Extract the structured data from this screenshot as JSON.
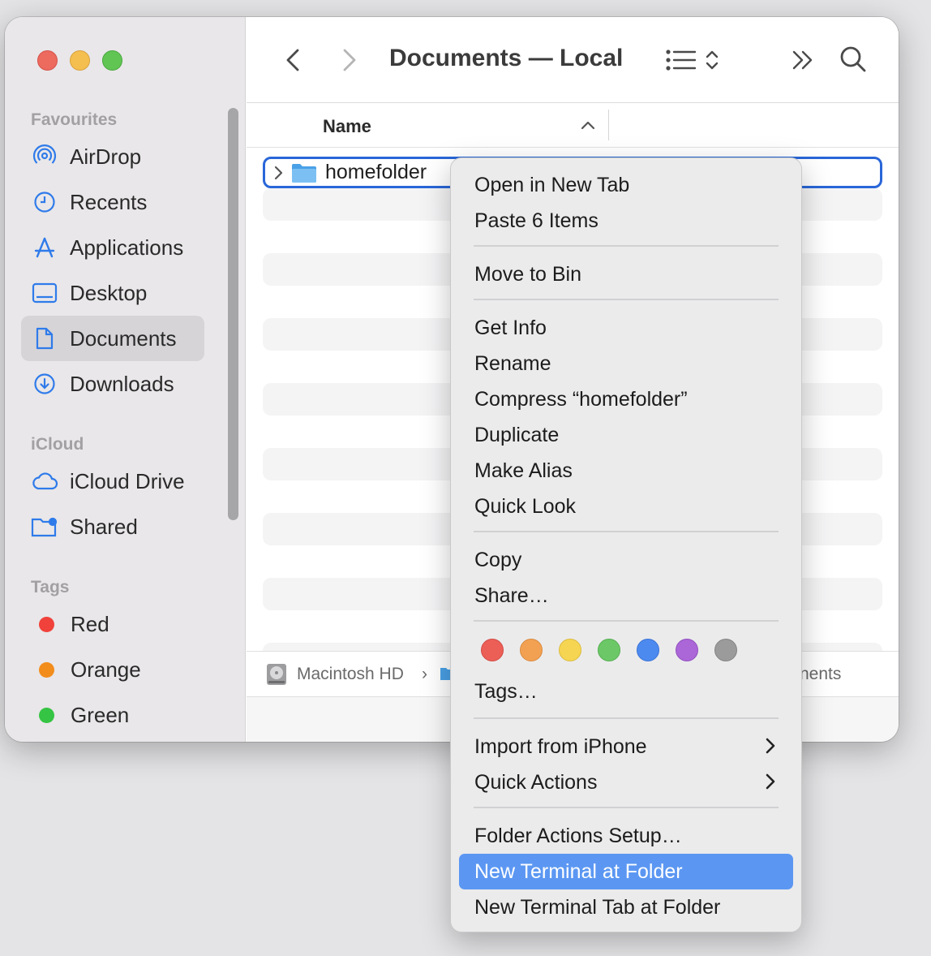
{
  "window": {
    "title": "Documents — Local"
  },
  "sidebar": {
    "sections": {
      "favourites": "Favourites",
      "icloud": "iCloud",
      "tags": "Tags"
    },
    "favourites": [
      {
        "label": "AirDrop",
        "icon": "airdrop-icon"
      },
      {
        "label": "Recents",
        "icon": "clock-icon"
      },
      {
        "label": "Applications",
        "icon": "applications-icon"
      },
      {
        "label": "Desktop",
        "icon": "desktop-icon"
      },
      {
        "label": "Documents",
        "icon": "document-icon",
        "selected": true
      },
      {
        "label": "Downloads",
        "icon": "download-icon"
      }
    ],
    "icloud": [
      {
        "label": "iCloud Drive",
        "icon": "cloud-icon"
      },
      {
        "label": "Shared",
        "icon": "shared-folder-icon"
      }
    ],
    "tags": [
      {
        "label": "Red",
        "color": "#f0413a"
      },
      {
        "label": "Orange",
        "color": "#f28c1b"
      },
      {
        "label": "Green",
        "color": "#35c443"
      }
    ]
  },
  "list": {
    "column_name": "Name",
    "row": {
      "name": "homefolder"
    }
  },
  "pathbar": {
    "disk": "Macintosh HD",
    "separator": "›",
    "tail": "nents"
  },
  "context_menu": {
    "group1": [
      "Open in New Tab",
      "Paste 6 Items"
    ],
    "group2": [
      "Move to Bin"
    ],
    "group3": [
      "Get Info",
      "Rename",
      "Compress “homefolder”",
      "Duplicate",
      "Make Alias",
      "Quick Look"
    ],
    "group4": [
      "Copy",
      "Share…"
    ],
    "tag_colors": [
      "#ec5f57",
      "#f2a153",
      "#f6d553",
      "#6cc867",
      "#4d8af0",
      "#ab66d8",
      "#9b9b9c"
    ],
    "tags_label": "Tags…",
    "group5": [
      "Import from iPhone",
      "Quick Actions"
    ],
    "group6": [
      "Folder Actions Setup…",
      "New Terminal at Folder",
      "New Terminal Tab at Folder"
    ],
    "highlighted": "New Terminal at Folder"
  }
}
